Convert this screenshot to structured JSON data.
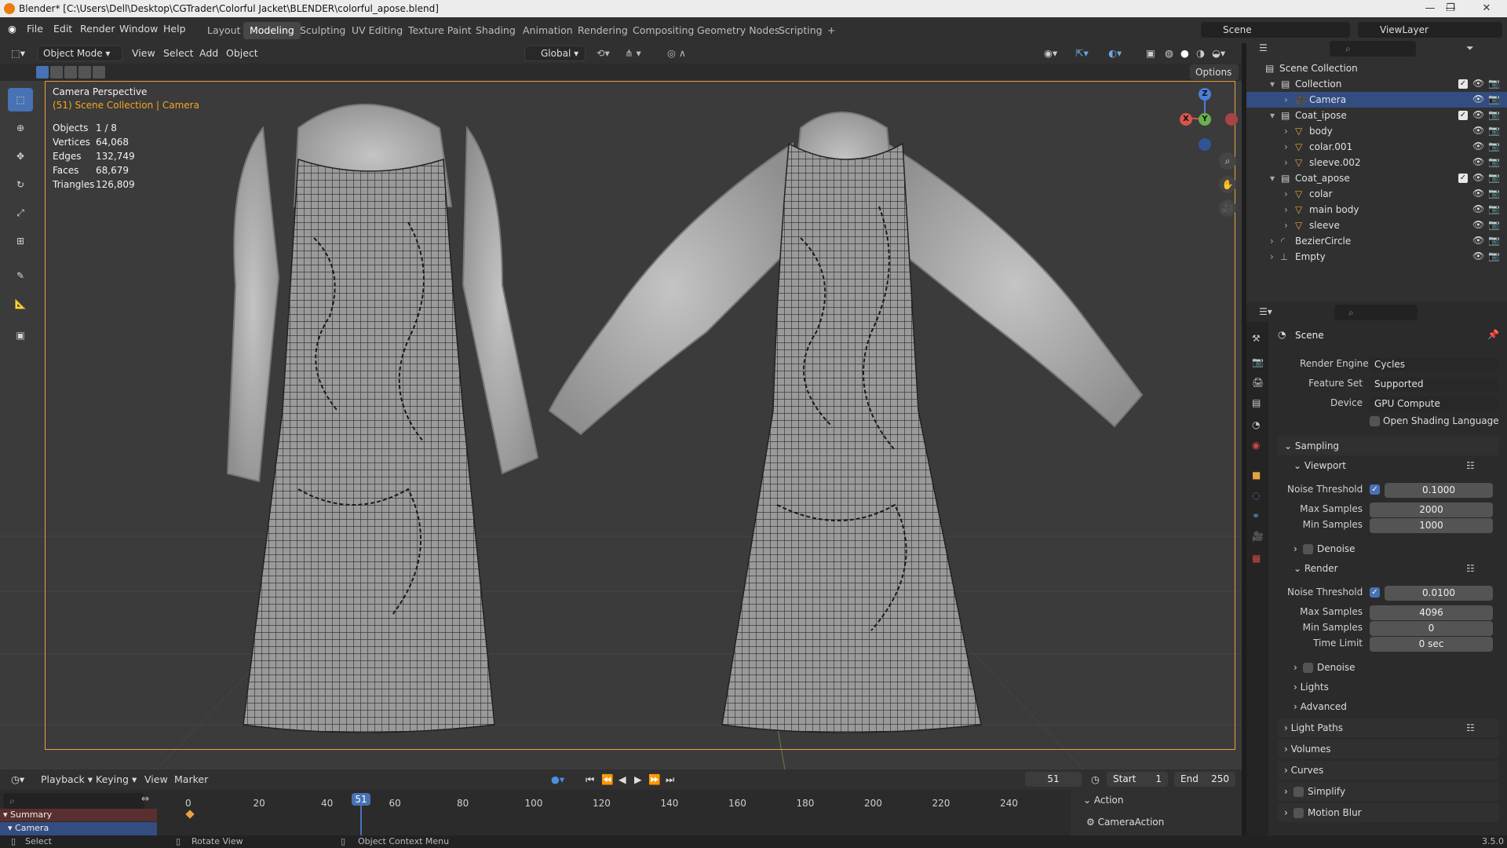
{
  "window": {
    "title": "Blender* [C:\\Users\\Dell\\Desktop\\CGTrader\\Colorful Jacket\\BLENDER\\colorful_apose.blend]",
    "minimize": "—",
    "maximize": "❐",
    "close": "✕"
  },
  "menu": [
    "File",
    "Edit",
    "Render",
    "Window",
    "Help"
  ],
  "workspaces": [
    "Layout",
    "Modeling",
    "Sculpting",
    "UV Editing",
    "Texture Paint",
    "Shading",
    "Animation",
    "Rendering",
    "Compositing",
    "Geometry Nodes",
    "Scripting",
    "+"
  ],
  "active_workspace": "Modeling",
  "scene": {
    "name": "Scene",
    "view_layer": "ViewLayer"
  },
  "header3d": {
    "mode": "Object Mode",
    "view": "View",
    "select": "Select",
    "add": "Add",
    "object": "Object",
    "transform": "Global",
    "options": "Options"
  },
  "viewport": {
    "title": "Camera Perspective",
    "subtitle": "(51) Scene Collection | Camera",
    "stats": [
      {
        "k": "Objects",
        "v": "1 / 8"
      },
      {
        "k": "Vertices",
        "v": "64,068"
      },
      {
        "k": "Edges",
        "v": "132,749"
      },
      {
        "k": "Faces",
        "v": "68,679"
      },
      {
        "k": "Triangles",
        "v": "126,809"
      }
    ],
    "gizmo": {
      "z": "Z",
      "y": "Y",
      "x": "X"
    }
  },
  "outliner": {
    "root": "Scene Collection",
    "rows": [
      {
        "name": "Collection",
        "indent": 1,
        "type": "collection"
      },
      {
        "name": "Camera",
        "indent": 2,
        "type": "camera",
        "selected": true
      },
      {
        "name": "Coat_ipose",
        "indent": 1,
        "type": "collection"
      },
      {
        "name": "body",
        "indent": 2,
        "type": "mesh"
      },
      {
        "name": "colar.001",
        "indent": 2,
        "type": "mesh"
      },
      {
        "name": "sleeve.002",
        "indent": 2,
        "type": "mesh"
      },
      {
        "name": "Coat_apose",
        "indent": 1,
        "type": "collection"
      },
      {
        "name": "colar",
        "indent": 2,
        "type": "mesh"
      },
      {
        "name": "main body",
        "indent": 2,
        "type": "mesh"
      },
      {
        "name": "sleeve",
        "indent": 2,
        "type": "mesh"
      },
      {
        "name": "BezierCircle",
        "indent": 1,
        "type": "curve"
      },
      {
        "name": "Empty",
        "indent": 1,
        "type": "empty"
      }
    ]
  },
  "properties": {
    "context": "Scene",
    "render_engine": {
      "label": "Render Engine",
      "value": "Cycles"
    },
    "feature_set": {
      "label": "Feature Set",
      "value": "Supported"
    },
    "device": {
      "label": "Device",
      "value": "GPU Compute"
    },
    "osl": "Open Shading Language",
    "sampling": "Sampling",
    "viewport": {
      "title": "Viewport",
      "noise_label": "Noise Threshold",
      "noise": "0.1000",
      "max_label": "Max Samples",
      "max": "2000",
      "min_label": "Min Samples",
      "min": "1000",
      "denoise": "Denoise"
    },
    "render": {
      "title": "Render",
      "noise_label": "Noise Threshold",
      "noise": "0.0100",
      "max_label": "Max Samples",
      "max": "4096",
      "min_label": "Min Samples",
      "min": "0",
      "time_label": "Time Limit",
      "time": "0 sec",
      "denoise": "Denoise"
    },
    "sub": [
      "Lights",
      "Advanced"
    ],
    "sections": [
      "Light Paths",
      "Volumes",
      "Curves",
      "Simplify",
      "Motion Blur"
    ]
  },
  "timeline": {
    "playback": "Playback",
    "keying": "Keying",
    "view": "View",
    "marker": "Marker",
    "current": "51",
    "start_label": "Start",
    "start": "1",
    "end_label": "End",
    "end": "250",
    "ticks": [
      "0",
      "20",
      "40",
      "60",
      "80",
      "100",
      "120",
      "140",
      "160",
      "180",
      "200",
      "220",
      "240"
    ],
    "summary": "Summary",
    "camera": "Camera",
    "action": "Action",
    "camera_action": "CameraAction"
  },
  "status": {
    "select": "Select",
    "rotate": "Rotate View",
    "context": "Object Context Menu",
    "version": "3.5.0"
  },
  "colors": {
    "accent": "#4772b3",
    "camera_frame": "#e8a33f",
    "highlight": "#f5a623"
  }
}
